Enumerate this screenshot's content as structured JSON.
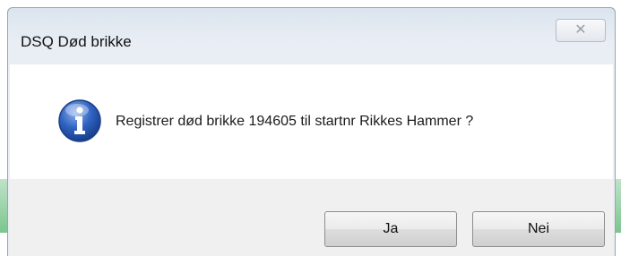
{
  "window": {
    "title": "DSQ Død brikke"
  },
  "close_button": {
    "glyph": "✕"
  },
  "message": {
    "icon": "info-icon",
    "text": "Registrer død brikke 194605 til startnr  Rikkes Hammer ?"
  },
  "buttons": {
    "yes_label": "Ja",
    "no_label": "Nei"
  },
  "colors": {
    "info_icon": "#2f62c0",
    "button_bar": "#f0f0f0"
  }
}
